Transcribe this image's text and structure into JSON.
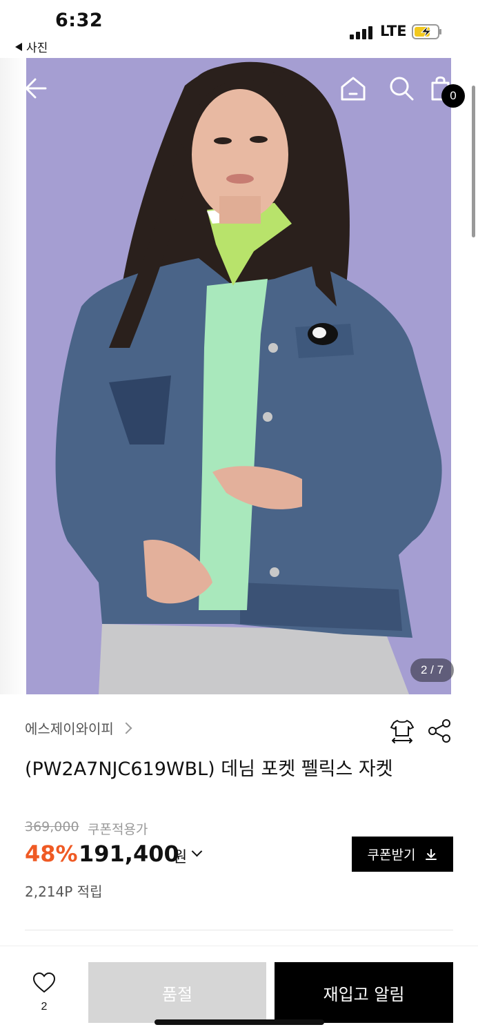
{
  "status_bar": {
    "time": "6:32",
    "back_app": "사진",
    "network": "LTE"
  },
  "header_icons": [
    "back-arrow-icon",
    "home-icon",
    "search-icon",
    "shopping-bag-icon"
  ],
  "cart": {
    "count": "0"
  },
  "image": {
    "description": "model wearing denim jacket with pocket character patch",
    "pager": "2 / 7",
    "background_color": "#a59ed2"
  },
  "product": {
    "brand": "에스제이와이피",
    "title": "(PW2A7NJC619WBL) 데님 포켓 펠릭스 자켓",
    "original_price": "369,000",
    "coupon_note": "쿠폰적용가",
    "discount": "48%",
    "sale_price": "191,400",
    "currency": "원",
    "points": "2,214P 적립"
  },
  "actions": {
    "coupon_button": "쿠폰받기",
    "wish_count": "2",
    "soldout": "품절",
    "restock": "재입고 알림"
  },
  "colors": {
    "accent": "#ef5a24",
    "primary": "#000000",
    "disabled": "#d6d6d6"
  }
}
